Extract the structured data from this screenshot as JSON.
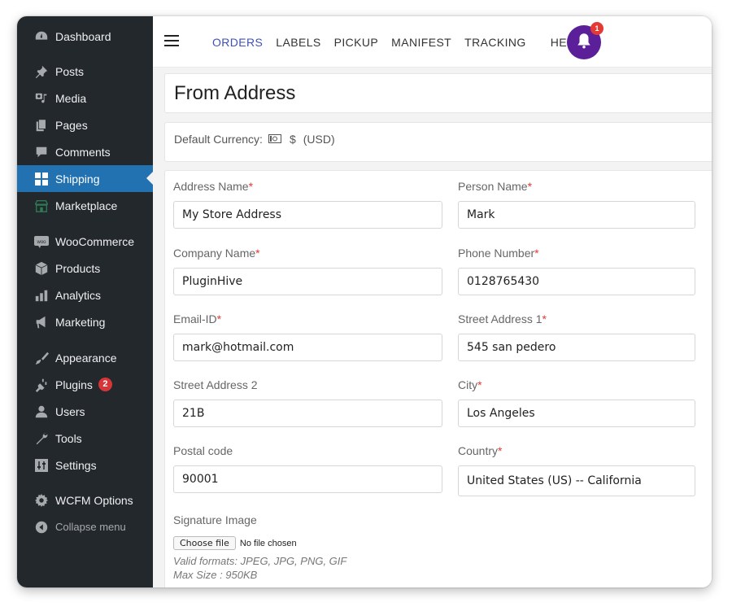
{
  "sidebar": {
    "items": [
      {
        "label": "Dashboard",
        "icon": "dashboard-icon"
      },
      {
        "label": "Posts",
        "icon": "pin-icon"
      },
      {
        "label": "Media",
        "icon": "media-icon"
      },
      {
        "label": "Pages",
        "icon": "pages-icon"
      },
      {
        "label": "Comments",
        "icon": "comment-icon"
      },
      {
        "label": "Shipping",
        "icon": "grid-icon",
        "active": true
      },
      {
        "label": "Marketplace",
        "icon": "store-icon"
      },
      {
        "label": "WooCommerce",
        "icon": "woo-icon"
      },
      {
        "label": "Products",
        "icon": "box-icon"
      },
      {
        "label": "Analytics",
        "icon": "bar-chart-icon"
      },
      {
        "label": "Marketing",
        "icon": "megaphone-icon"
      },
      {
        "label": "Appearance",
        "icon": "brush-icon"
      },
      {
        "label": "Plugins",
        "icon": "plug-icon",
        "badge": "2"
      },
      {
        "label": "Users",
        "icon": "user-icon"
      },
      {
        "label": "Tools",
        "icon": "wrench-icon"
      },
      {
        "label": "Settings",
        "icon": "sliders-icon"
      },
      {
        "label": "WCFM Options",
        "icon": "gear-icon"
      },
      {
        "label": "Collapse menu",
        "icon": "collapse-icon"
      }
    ]
  },
  "topnav": {
    "tabs": [
      "ORDERS",
      "LABELS",
      "PICKUP",
      "MANIFEST",
      "TRACKING",
      "HELP"
    ],
    "active": "ORDERS",
    "notification_count": "1"
  },
  "page": {
    "title": "From Address",
    "currency_label": "Default Currency:",
    "currency_symbol": "$",
    "currency_code": "(USD)"
  },
  "form": {
    "address_name": {
      "label": "Address Name",
      "required": "*",
      "value": "My Store Address"
    },
    "person_name": {
      "label": "Person Name",
      "required": "*",
      "value": "Mark"
    },
    "company_name": {
      "label": "Company Name",
      "required": "*",
      "value": "PluginHive"
    },
    "phone_number": {
      "label": "Phone Number",
      "required": "*",
      "value": "0128765430"
    },
    "email": {
      "label": "Email-ID",
      "required": "*",
      "value": "mark@hotmail.com"
    },
    "street1": {
      "label": "Street Address 1",
      "required": "*",
      "value": "545 san pedero"
    },
    "street2": {
      "label": "Street Address 2",
      "value": "21B"
    },
    "city": {
      "label": "City",
      "required": "*",
      "value": "Los Angeles"
    },
    "postal": {
      "label": "Postal code",
      "value": "90001"
    },
    "country": {
      "label": "Country",
      "required": "*",
      "value": "United States (US) -- California"
    },
    "signature": {
      "label": "Signature Image",
      "button": "Choose file",
      "status": "No file chosen",
      "hint_formats": "Valid formats: JPEG, JPG, PNG, GIF",
      "hint_size": "Max Size : 950KB"
    }
  },
  "colors": {
    "sidebar_bg": "#23282d",
    "active_item": "#2271b1",
    "nav_active": "#3f51b5",
    "bell_bg": "#5b1f99",
    "badge": "#d63638",
    "required": "#e53935"
  }
}
